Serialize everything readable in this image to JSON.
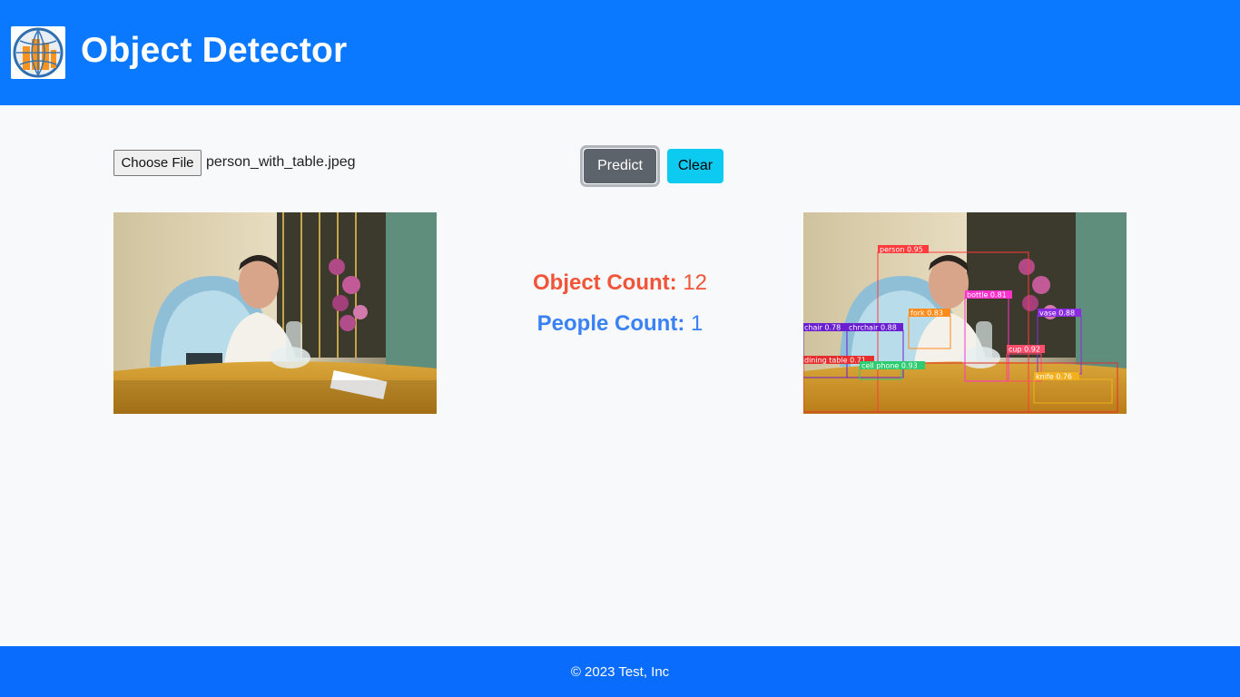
{
  "header": {
    "title": "Object Detector",
    "logo_icon": "globe-buildings-logo"
  },
  "upload": {
    "choose_label": "Choose File",
    "file_name": "person_with_table.jpeg"
  },
  "actions": {
    "predict_label": "Predict",
    "clear_label": "Clear"
  },
  "stats": {
    "object_label": "Object Count:",
    "object_value": "12",
    "people_label": "People Count:",
    "people_value": "1"
  },
  "detections": [
    {
      "label": "person 0.95",
      "color": "#ff3b3b"
    },
    {
      "label": "bottle 0.81",
      "color": "#ff33cc"
    },
    {
      "label": "fork 0.83",
      "color": "#ff8c1a"
    },
    {
      "label": "vase 0.88",
      "color": "#8a2be2"
    },
    {
      "label": "chair 0.78",
      "color": "#6a1fd1"
    },
    {
      "label": "chrchair 0.88",
      "color": "#6a1fd1"
    },
    {
      "label": "cup 0.92",
      "color": "#ff4d6d"
    },
    {
      "label": "dining table 0.71",
      "color": "#e62e2e"
    },
    {
      "label": "cell phone 0.93",
      "color": "#2ecc71"
    },
    {
      "label": "knife 0.76",
      "color": "#f2b01e"
    }
  ],
  "colors": {
    "header_bg": "#0a79ff",
    "footer_bg": "#0a6cfd",
    "object_count": "#f0553a",
    "people_count": "#3a82f4",
    "predict_bg": "#5c636a",
    "clear_bg": "#0dcaf0"
  },
  "footer": {
    "copyright": "© 2023 Test, Inc"
  }
}
